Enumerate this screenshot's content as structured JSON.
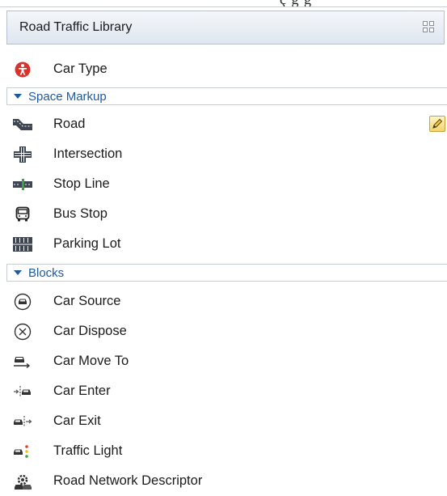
{
  "window": {
    "cut_text": "ç g g"
  },
  "panel": {
    "title": "Road Traffic Library"
  },
  "top_items": [
    {
      "label": "Car Type",
      "icon": "car-type-icon"
    }
  ],
  "sections": [
    {
      "label": "Space Markup",
      "items": [
        {
          "label": "Road",
          "icon": "road-icon"
        },
        {
          "label": "Intersection",
          "icon": "intersection-icon"
        },
        {
          "label": "Stop Line",
          "icon": "stop-line-icon"
        },
        {
          "label": "Bus Stop",
          "icon": "bus-stop-icon"
        },
        {
          "label": "Parking Lot",
          "icon": "parking-lot-icon"
        }
      ]
    },
    {
      "label": "Blocks",
      "items": [
        {
          "label": "Car Source",
          "icon": "car-source-icon"
        },
        {
          "label": "Car Dispose",
          "icon": "car-dispose-icon"
        },
        {
          "label": "Car Move To",
          "icon": "car-move-to-icon"
        },
        {
          "label": "Car Enter",
          "icon": "car-enter-icon"
        },
        {
          "label": "Car Exit",
          "icon": "car-exit-icon"
        },
        {
          "label": "Traffic Light",
          "icon": "traffic-light-icon"
        },
        {
          "label": "Road Network Descriptor",
          "icon": "road-network-descriptor-icon"
        }
      ]
    }
  ],
  "colors": {
    "accent": "#1e5a9e",
    "car_type_red": "#d8322b",
    "stop_green": "#3aa63a"
  }
}
